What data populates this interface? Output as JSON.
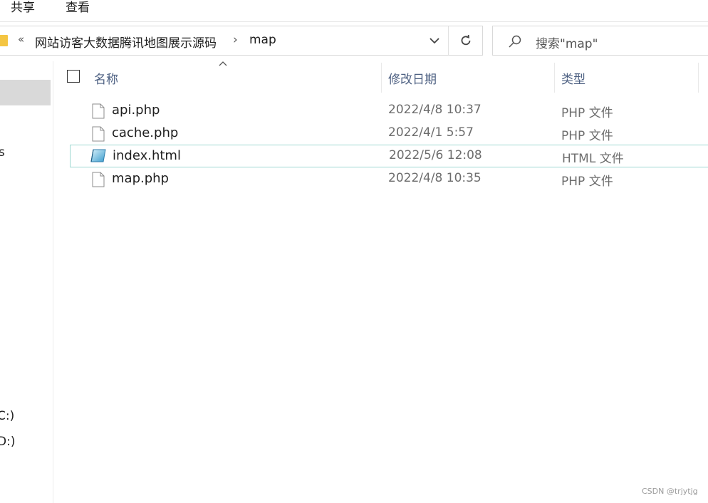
{
  "ribbon": {
    "tabs": [
      {
        "label": "共享"
      },
      {
        "label": "查看"
      }
    ]
  },
  "address": {
    "overflow": "«",
    "crumbs": [
      {
        "label": "网站访客大数据腾讯地图展示源码"
      },
      {
        "label": "map"
      }
    ],
    "separator": "›"
  },
  "search": {
    "placeholder": "搜索\"map\""
  },
  "nav": {
    "items": [
      {
        "label": "s"
      },
      {
        "label": "C:)"
      },
      {
        "label": "D:)"
      }
    ]
  },
  "columns": [
    {
      "label": "名称"
    },
    {
      "label": "修改日期"
    },
    {
      "label": "类型"
    }
  ],
  "files": [
    {
      "name": "api.php",
      "date": "2022/4/8 10:37",
      "type": "PHP 文件",
      "icon": "php-file-icon"
    },
    {
      "name": "cache.php",
      "date": "2022/4/1 5:57",
      "type": "PHP 文件",
      "icon": "php-file-icon"
    },
    {
      "name": "index.html",
      "date": "2022/5/6 12:08",
      "type": "HTML 文件",
      "icon": "html-file-icon"
    },
    {
      "name": "map.php",
      "date": "2022/4/8 10:35",
      "type": "PHP 文件",
      "icon": "php-file-icon"
    }
  ],
  "watermark": "CSDN @trjytjg",
  "colors": {
    "selection_border": "#9fd8d2",
    "nav_selected": "#d9d9d9",
    "header_text": "#4d6082"
  }
}
